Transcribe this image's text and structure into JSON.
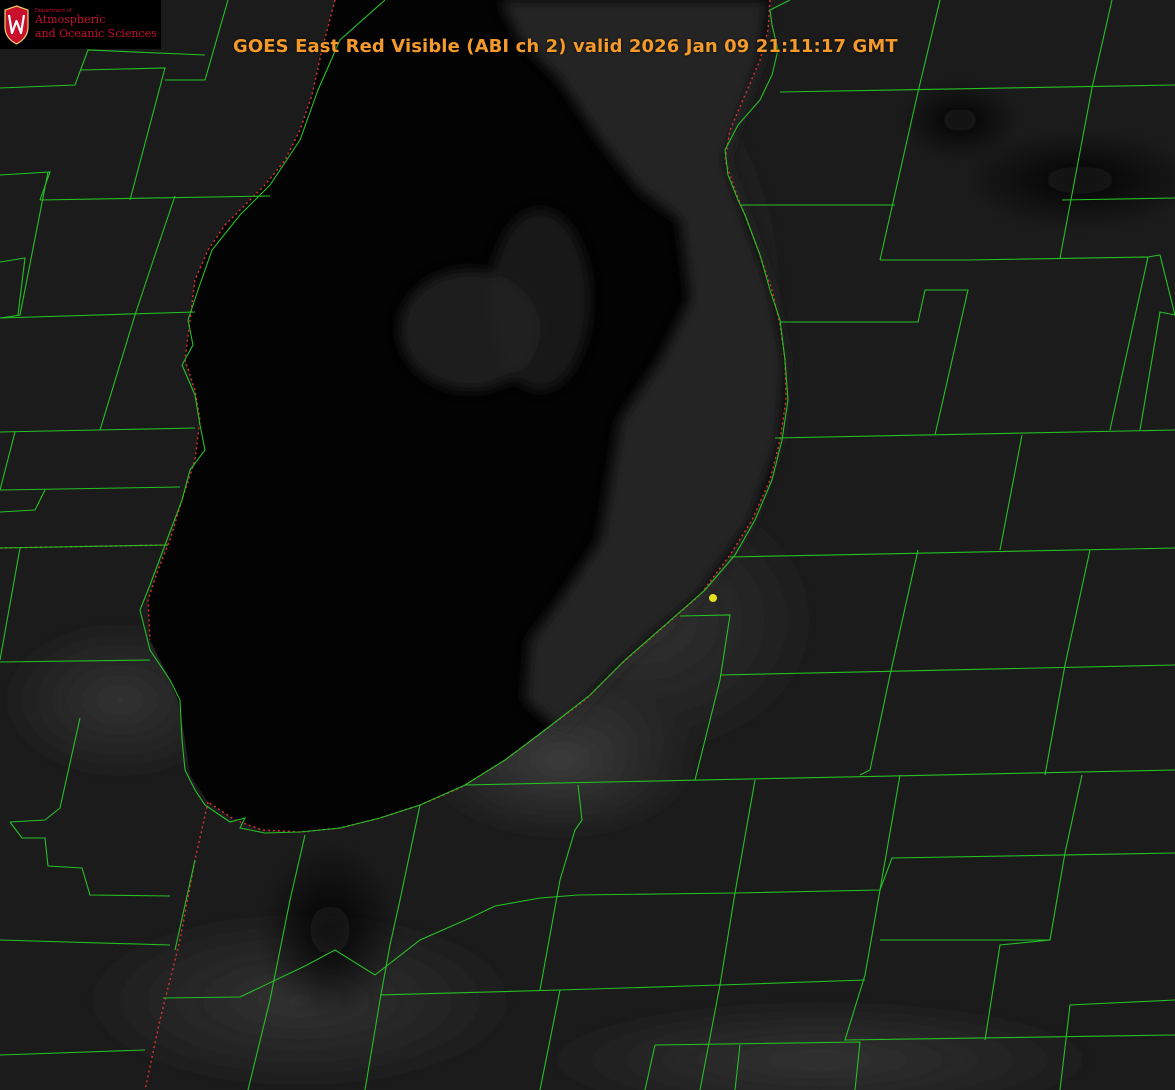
{
  "image_title": "GOES East Red Visible (ABI ch 2) valid 2026 Jan 09 21:11:17 GMT",
  "logo": {
    "small_text": "Department of",
    "line1": "Atmospheric",
    "line2": "and Oceanic Sciences"
  },
  "colors": {
    "title": "#f39a2a",
    "boundaries": "#25c025",
    "state_line": "#e03030",
    "marker": "#e4e020",
    "lake": "#030303",
    "land": "#1b1b1b",
    "logo_red": "#c8102e"
  },
  "icons": {
    "logo": "university-shield-icon",
    "marker": "location-dot-icon"
  }
}
